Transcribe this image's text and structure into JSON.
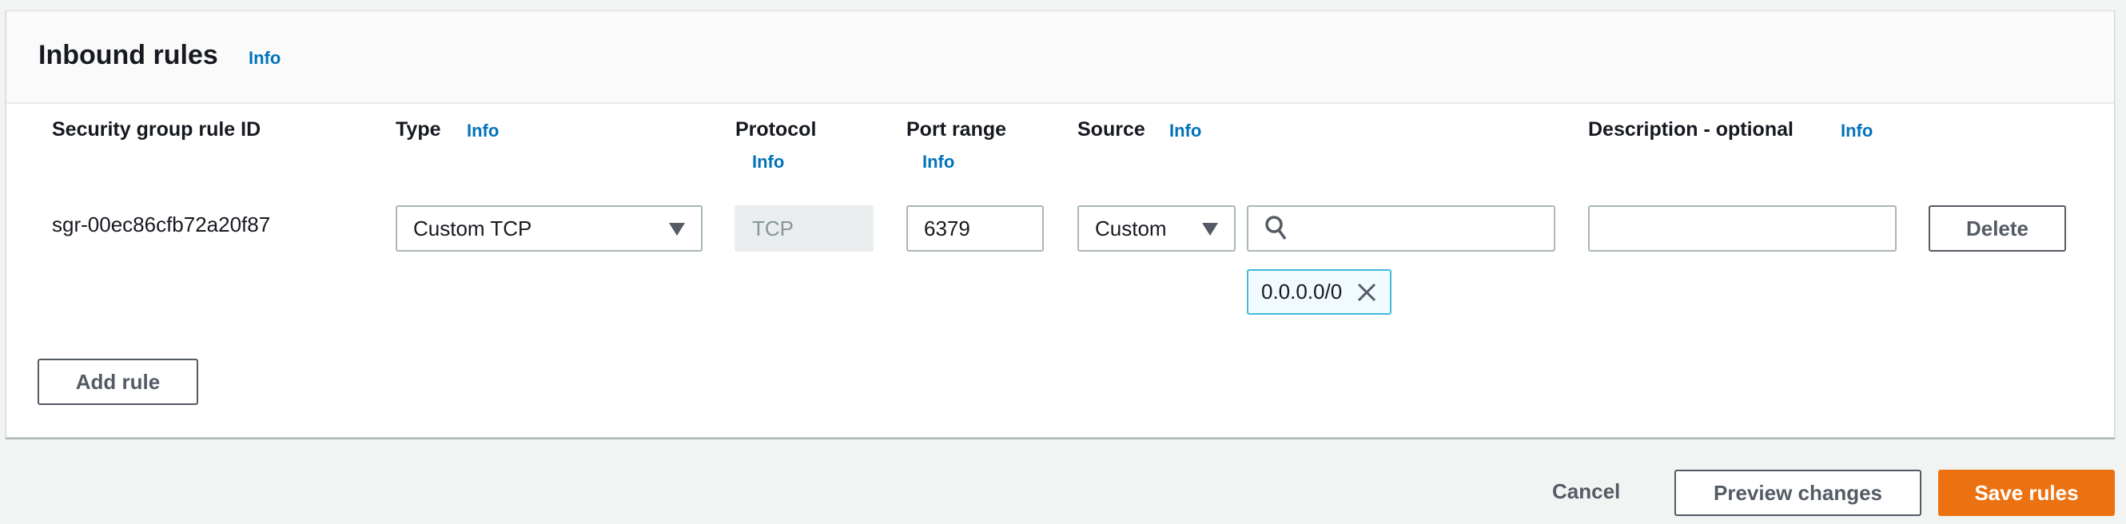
{
  "panel": {
    "title": "Inbound rules",
    "info": "Info"
  },
  "columns": [
    {
      "label": "Security group rule ID"
    },
    {
      "label": "Type",
      "info": "Info"
    },
    {
      "label": "Protocol",
      "info": "Info"
    },
    {
      "label": "Port range",
      "info": "Info"
    },
    {
      "label": "Source",
      "info": "Info"
    },
    {
      "label": "Description - optional",
      "info": "Info"
    }
  ],
  "rule": {
    "id": "sgr-00ec86cfb72a20f87",
    "type": "Custom TCP",
    "protocol": "TCP",
    "port_range": "6379",
    "source_type": "Custom",
    "source_search": "",
    "source_tokens": [
      "0.0.0.0/0"
    ],
    "description": "",
    "delete_label": "Delete"
  },
  "add_rule_label": "Add rule",
  "footer": {
    "cancel": "Cancel",
    "preview": "Preview changes",
    "save": "Save rules"
  },
  "colors": {
    "accent": "#ec7211",
    "link": "#0073bb"
  },
  "icons": {
    "select": "caret-down",
    "search": "magnifier",
    "remove": "x"
  }
}
